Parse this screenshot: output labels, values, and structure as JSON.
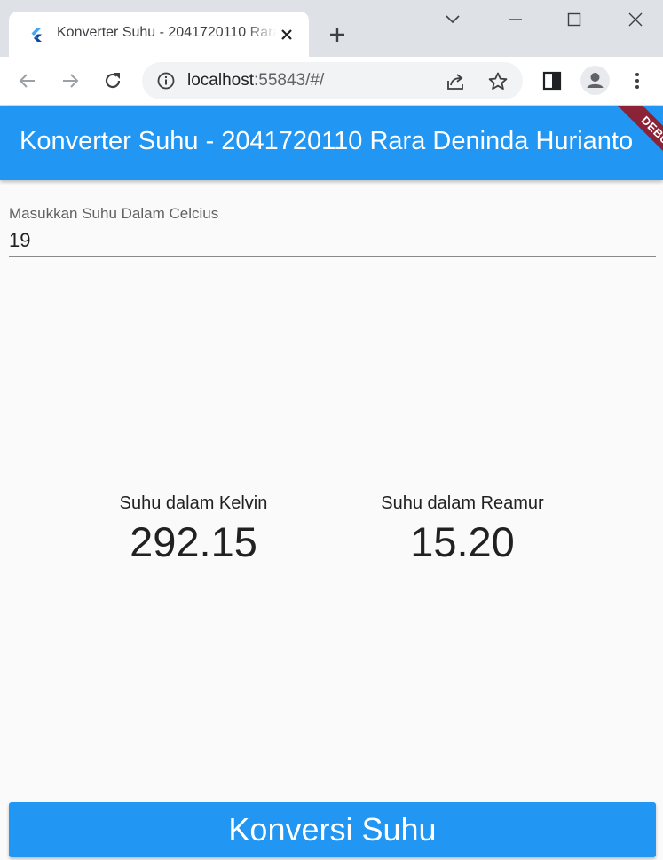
{
  "browser": {
    "tab_title": "Konverter Suhu - 2041720110 Rara Deninda Hurianto",
    "url_host": "localhost",
    "url_rest": ":55843/#/"
  },
  "app": {
    "title": "Konverter Suhu - 2041720110 Rara Deninda Hurianto",
    "debug_label": "DEBUG"
  },
  "input": {
    "label": "Masukkan Suhu Dalam Celcius",
    "value": "19"
  },
  "results": {
    "kelvin_label": "Suhu dalam Kelvin",
    "kelvin_value": "292.15",
    "reamur_label": "Suhu dalam Reamur",
    "reamur_value": "15.20"
  },
  "button": {
    "label": "Konversi Suhu"
  },
  "colors": {
    "primary": "#2196f3",
    "debug_ribbon": "#8b2236"
  }
}
